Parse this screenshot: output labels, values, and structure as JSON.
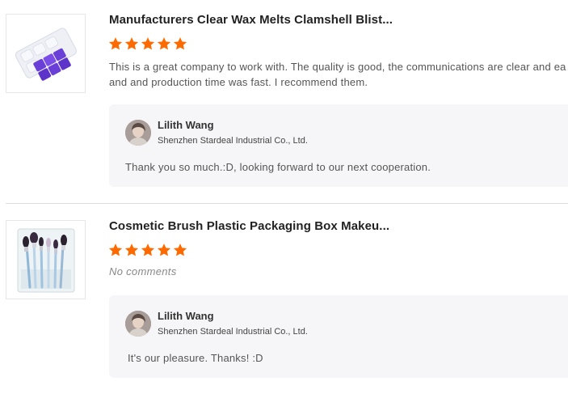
{
  "reviews": [
    {
      "product_title": "Manufacturers Clear Wax Melts Clamshell Blist...",
      "rating": 5,
      "comment_lines": [
        "This is a great company to work with.  The quality is good, the communications are clear and ea",
        "and and production time was fast.  I recommend them."
      ],
      "reply": {
        "name": "Lilith Wang",
        "company": "Shenzhen Stardeal Industrial Co., Ltd.",
        "text": "Thank you so much.:D, looking forward to our next cooperation."
      }
    },
    {
      "product_title": "Cosmetic Brush Plastic Packaging Box Makeu...",
      "rating": 5,
      "no_comments": "No comments",
      "reply": {
        "name": "Lilith Wang",
        "company": "Shenzhen Stardeal Industrial Co., Ltd.",
        "text": "It's our pleasure. Thanks! :D"
      }
    }
  ],
  "colors": {
    "star": "#ff6a00",
    "reply_background": "#f6f6f8",
    "divider": "#dddddd"
  },
  "icons": {
    "star": "star-icon",
    "product_image_1": "wax-melt-clamshell-image",
    "product_image_2": "brush-packaging-box-image",
    "avatar": "user-avatar"
  }
}
